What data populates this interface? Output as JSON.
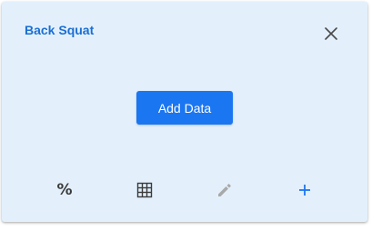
{
  "card": {
    "title": "Back Squat",
    "add_data_label": "Add Data"
  },
  "icons": {
    "close": "close-icon",
    "percent": "percent-icon",
    "grid": "grid-icon",
    "edit": "pencil-icon",
    "add": "plus-icon"
  },
  "toolbar": {
    "percent_glyph": "%"
  },
  "colors": {
    "card_background": "#e3f0fc",
    "title": "#1b6fd3",
    "primary_button": "#1b76f2",
    "icon_dark": "#3a3a3a",
    "icon_disabled": "#a9a9a9",
    "icon_accent": "#1b76f2"
  }
}
